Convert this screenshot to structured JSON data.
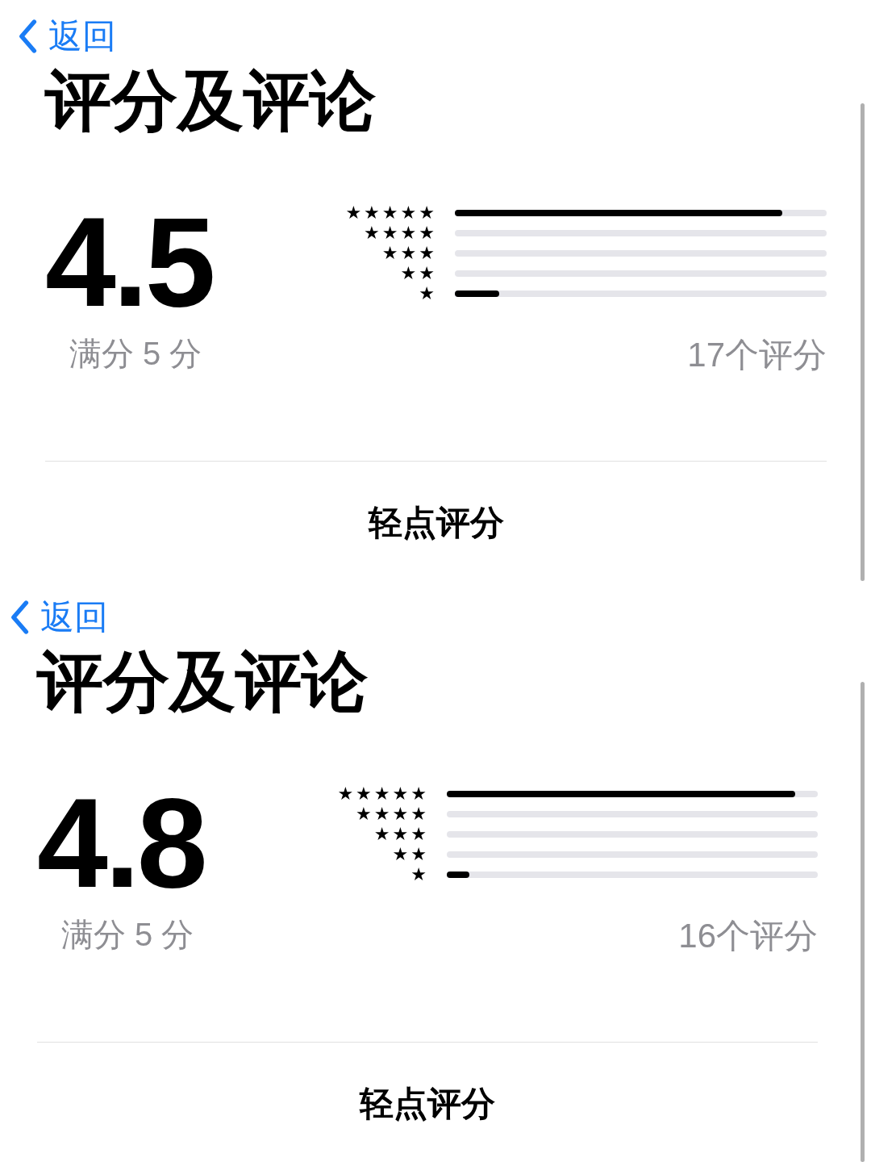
{
  "panels": [
    {
      "back": "返回",
      "title": "评分及评论",
      "score": "4.5",
      "out_of": "满分 5 分",
      "count": "17个评分",
      "tap_to_rate": "轻点评分",
      "bars": [
        {
          "label": "★★★★★",
          "level": 0.88
        },
        {
          "label": "★★★★"
        },
        {
          "label": "★★★"
        },
        {
          "label": "★★"
        },
        {
          "label": "★",
          "level": 0.12
        }
      ]
    },
    {
      "back": "返回",
      "title": "评分及评论",
      "score": "4.8",
      "out_of": "满分 5 分",
      "count": "16个评分",
      "tap_to_rate": "轻点评分",
      "bars": [
        {
          "label": "★★★★★",
          "level": 0.94
        },
        {
          "label": "★★★★"
        },
        {
          "label": "★★★"
        },
        {
          "label": "★★"
        },
        {
          "label": "★",
          "level": 0.06
        }
      ]
    }
  ]
}
